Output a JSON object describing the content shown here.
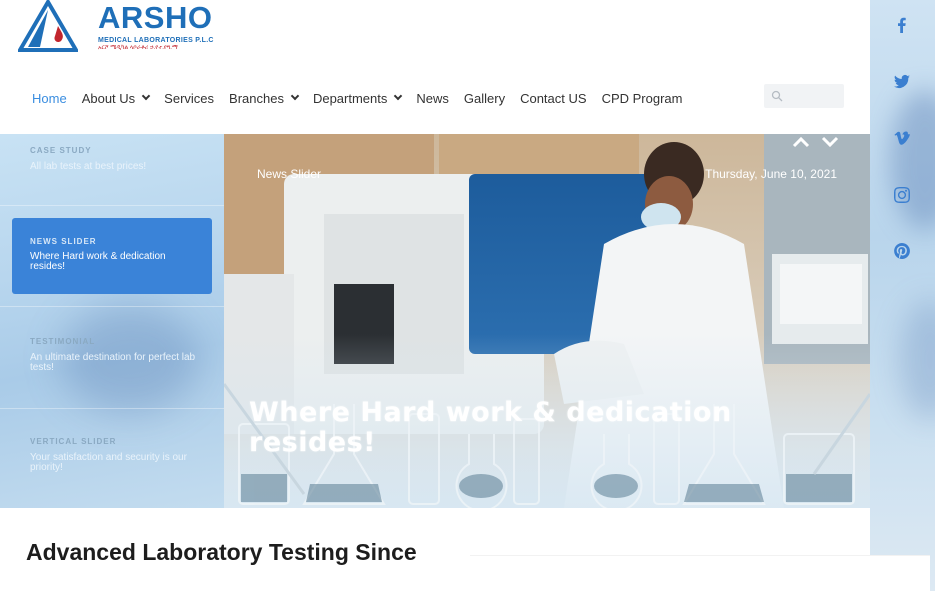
{
  "logo": {
    "name": "ARSHO",
    "subtitle": "MEDICAL LABORATORIES P.L.C",
    "amharic": "አርሾ ሜዲካል ላቦራቶሪ ኃ.የተ.የግ.ማ"
  },
  "nav": {
    "items": [
      {
        "label": "Home",
        "active": true,
        "dropdown": false
      },
      {
        "label": "About Us",
        "active": false,
        "dropdown": true
      },
      {
        "label": "Services",
        "active": false,
        "dropdown": false
      },
      {
        "label": "Branches",
        "active": false,
        "dropdown": true
      },
      {
        "label": "Departments",
        "active": false,
        "dropdown": true
      },
      {
        "label": "News",
        "active": false,
        "dropdown": false
      },
      {
        "label": "Gallery",
        "active": false,
        "dropdown": false
      },
      {
        "label": "Contact US",
        "active": false,
        "dropdown": false
      },
      {
        "label": "CPD Program",
        "active": false,
        "dropdown": false
      }
    ],
    "search_placeholder": ""
  },
  "slider_menu": {
    "items": [
      {
        "category": "CASE STUDY",
        "text": "All lab tests at best prices!",
        "active": false
      },
      {
        "category": "NEWS SLIDER",
        "text": "Where Hard work & dedication resides!",
        "active": true
      },
      {
        "category": "TESTIMONIAL",
        "text": "An ultimate destination for perfect lab tests!",
        "active": false
      },
      {
        "category": "VERTICAL SLIDER",
        "text": "Your satisfaction and security is our priority!",
        "active": false
      }
    ]
  },
  "hero": {
    "label": "News Slider",
    "date": "Thursday, June 10, 2021",
    "title": "Where Hard work & dedication resides!"
  },
  "social": [
    "facebook-icon",
    "twitter-icon",
    "vimeo-icon",
    "instagram-icon",
    "pinterest-icon"
  ],
  "main": {
    "headline": "Advanced Laboratory Testing Since"
  },
  "colors": {
    "brand_blue": "#1f6fb8",
    "accent_blue": "#3a83d8",
    "brand_red": "#c2262e"
  }
}
